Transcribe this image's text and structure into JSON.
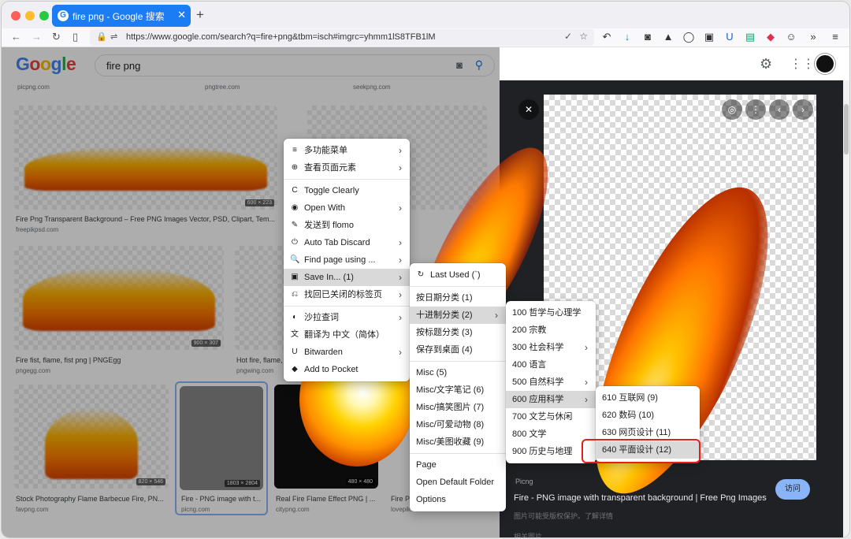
{
  "browser": {
    "tab_title": "fire png - Google 搜索",
    "tab_favicon": "G",
    "new_tab": "+",
    "url": "https://www.google.com/search?q=fire+png&tbm=isch#imgrc=yhmm1lS8TFB1lM"
  },
  "google": {
    "logo": "Google",
    "query": "fire png"
  },
  "grid": [
    {
      "caption": "",
      "source": "picpng.com",
      "dim": ""
    },
    {
      "caption": "",
      "source": "pngtree.com",
      "dim": ""
    },
    {
      "caption": "",
      "source": "seekpng.com",
      "dim": ""
    },
    {
      "caption": "Fire Png Transparent Background – Free PNG Images Vector, PSD, Clipart, Tem...",
      "source": "freepikpsd.com",
      "dim": "600 × 223"
    },
    {
      "caption": "Fire fist, flame, fist png | PNGEgg",
      "source": "pngegg.com",
      "dim": "900 × 307"
    },
    {
      "caption": "Hot fire, flame, ...",
      "source": "pngwing.com",
      "dim": ""
    },
    {
      "caption": "Stock Photography Flame Barbecue Fire, PN...",
      "source": "favpng.com",
      "dim": "820 × 546"
    },
    {
      "caption": "Fire - PNG image with t...",
      "source": "picng.com",
      "dim": "1803 × 2804"
    },
    {
      "caption": "Real Fire Flame Effect PNG | ...",
      "source": "citypng.com",
      "dim": "480 × 480"
    },
    {
      "caption": "Fire PN...",
      "source": "lovepik...",
      "dim": ""
    }
  ],
  "panel": {
    "source": "Picng",
    "title": "Fire - PNG image with transparent background | Free Png Images",
    "note": "图片可能受版权保护。了解详情",
    "related": "相关图片",
    "visit": "访问"
  },
  "menu1": [
    {
      "icon": "≡",
      "label": "多功能菜单",
      "arrow": true
    },
    {
      "icon": "⊕",
      "label": "查看页面元素",
      "arrow": true
    },
    {
      "sep": true
    },
    {
      "icon": "C",
      "label": "Toggle Clearly",
      "arrow": false
    },
    {
      "icon": "◉",
      "label": "Open With",
      "arrow": true
    },
    {
      "icon": "✎",
      "label": "发送到 flomo",
      "arrow": false
    },
    {
      "icon": "⏻",
      "label": "Auto Tab Discard",
      "arrow": true
    },
    {
      "icon": "🔍",
      "label": "Find page using ...",
      "arrow": true
    },
    {
      "icon": "▣",
      "label": "Save In... (1)",
      "arrow": true,
      "hl": true
    },
    {
      "icon": "⎌",
      "label": "找回已关闭的标签页",
      "arrow": true
    },
    {
      "sep": true
    },
    {
      "icon": "◐",
      "label": "沙拉查词",
      "arrow": true
    },
    {
      "icon": "文",
      "label": "翻译为 中文（简体）",
      "arrow": false
    },
    {
      "icon": "U",
      "label": "Bitwarden",
      "arrow": true
    },
    {
      "icon": "◆",
      "label": "Add to Pocket",
      "arrow": false
    }
  ],
  "menu2": [
    {
      "icon": "↻",
      "label": "Last Used (`)",
      "arrow": false
    },
    {
      "sep": true
    },
    {
      "label": "按日期分类 (1)",
      "arrow": false
    },
    {
      "label": "十进制分类 (2)",
      "arrow": true,
      "hl": true
    },
    {
      "label": "按标题分类 (3)",
      "arrow": false
    },
    {
      "label": "保存到桌面 (4)",
      "arrow": false
    },
    {
      "sep": true
    },
    {
      "label": "Misc (5)",
      "arrow": false
    },
    {
      "label": "Misc/文字笔记 (6)",
      "arrow": false
    },
    {
      "label": "Misc/搞笑图片 (7)",
      "arrow": false
    },
    {
      "label": "Misc/可爱动物 (8)",
      "arrow": false
    },
    {
      "label": "Misc/美图收藏 (9)",
      "arrow": false
    },
    {
      "sep": true
    },
    {
      "label": "Page",
      "arrow": false
    },
    {
      "label": "Open Default Folder",
      "arrow": false
    },
    {
      "label": "Options",
      "arrow": false
    }
  ],
  "menu3": [
    {
      "label": "100 哲学与心理学",
      "arrow": false
    },
    {
      "label": "200 宗教",
      "arrow": false
    },
    {
      "label": "300 社会科学",
      "arrow": true
    },
    {
      "label": "400 语言",
      "arrow": false
    },
    {
      "label": "500 自然科学",
      "arrow": true
    },
    {
      "label": "600 应用科学",
      "arrow": true,
      "hl": true
    },
    {
      "label": "700 文艺与休闲",
      "arrow": false
    },
    {
      "label": "800 文学",
      "arrow": false
    },
    {
      "label": "900 历史与地理",
      "arrow": false
    }
  ],
  "menu4": [
    {
      "label": "610 互联网 (9)",
      "arrow": false
    },
    {
      "label": "620 数码 (10)",
      "arrow": false
    },
    {
      "label": "630 网页设计 (11)",
      "arrow": false
    },
    {
      "label": "640 平面设计 (12)",
      "arrow": false,
      "hl": true
    }
  ],
  "colors": {
    "accent": "#1b7cf3",
    "highlight": "#e0201c"
  }
}
